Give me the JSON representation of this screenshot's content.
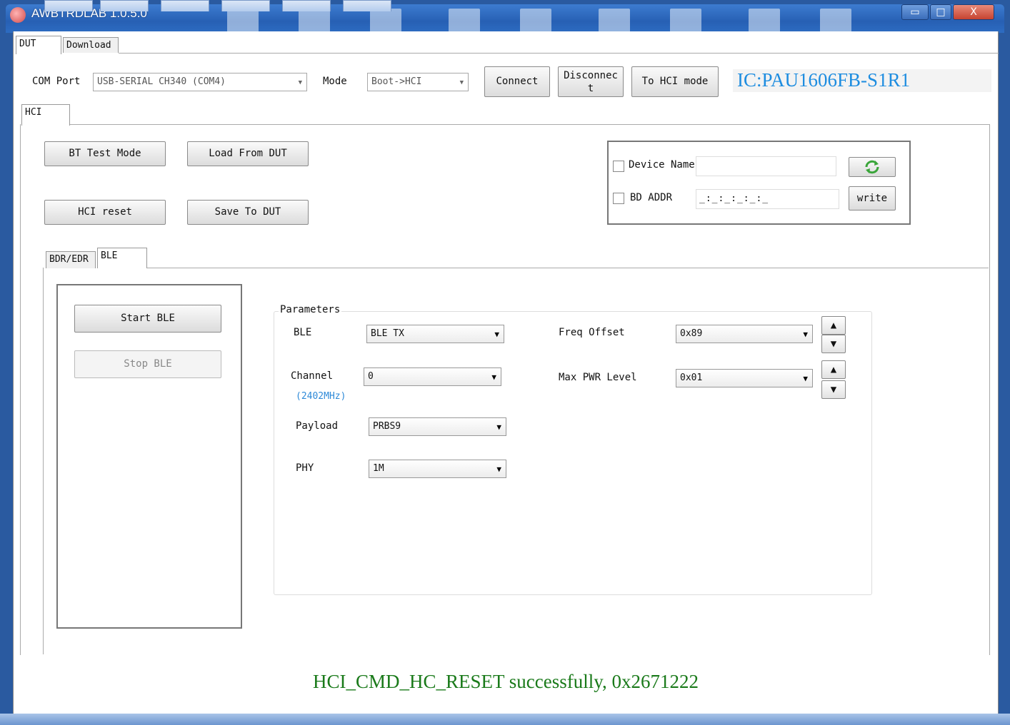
{
  "app": {
    "title": "AWBTRDLAB 1.0.5.0"
  },
  "window_controls": {
    "minimize": "▭",
    "maximize": "□",
    "close": "X"
  },
  "top_tabs": [
    {
      "label": "DUT",
      "active": true
    },
    {
      "label": "Download",
      "active": false
    }
  ],
  "connection": {
    "com_port_label": "COM Port",
    "com_port_value": "USB-SERIAL CH340 (COM4)",
    "mode_label": "Mode",
    "mode_value": "Boot->HCI",
    "connect_label": "Connect",
    "disconnect_label": "Disconnect",
    "to_hci_label": "To HCI mode",
    "ic_label": "IC:PAU1606FB-S1R1"
  },
  "hci_tab": {
    "label": "HCI"
  },
  "hci_buttons": {
    "bt_test_mode": "BT Test Mode",
    "load_from_dut": "Load From DUT",
    "hci_reset": "HCI reset",
    "save_to_dut": "Save To DUT"
  },
  "device_panel": {
    "device_name_label": "Device Name",
    "device_name_value": "",
    "bd_addr_label": "BD ADDR",
    "bd_addr_value": "_:_:_:_:_:_",
    "write_label": "write"
  },
  "sub_tabs": [
    {
      "label": "BDR/EDR",
      "active": false
    },
    {
      "label": "BLE",
      "active": true
    }
  ],
  "ble_controls": {
    "start_label": "Start BLE",
    "stop_label": "Stop BLE"
  },
  "parameters": {
    "group_label": "Parameters",
    "ble_label": "BLE",
    "ble_value": "BLE TX",
    "channel_label": "Channel",
    "channel_value": "0",
    "channel_freq": "(2402MHz)",
    "payload_label": "Payload",
    "payload_value": "PRBS9",
    "phy_label": "PHY",
    "phy_value": "1M",
    "freq_offset_label": "Freq Offset",
    "freq_offset_value": "0x89",
    "max_pwr_label": "Max PWR Level",
    "max_pwr_value": "0x01"
  },
  "status": {
    "message": "HCI_CMD_HC_RESET successfully, 0x2671222"
  },
  "colors": {
    "ic_label": "#1e8de0",
    "status": "#1a7a1a",
    "freq": "#2e8ad8"
  },
  "icons": {
    "refresh": "refresh-icon",
    "arrow_up": "arrow-up-icon",
    "arrow_down": "arrow-down-icon"
  }
}
